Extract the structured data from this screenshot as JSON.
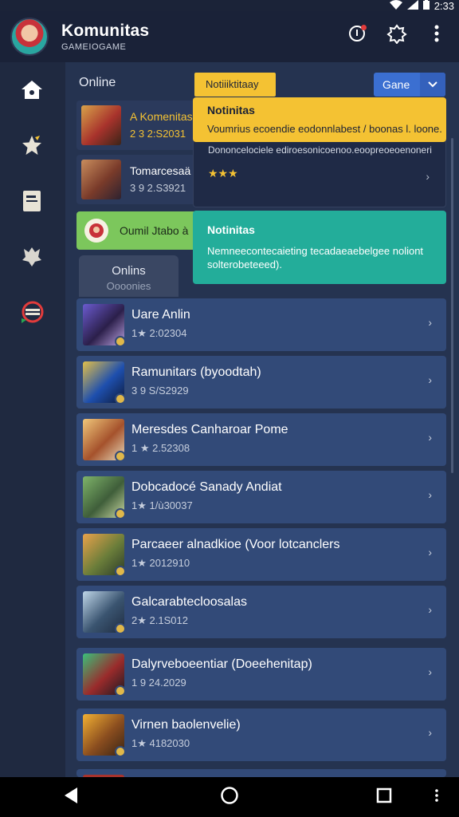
{
  "status_bar": {
    "time": "2:33"
  },
  "app": {
    "name": "Komunitas",
    "subtitle": "GAMEIOGAME"
  },
  "header": {
    "online_label": "Online",
    "tag_label": "Notiiiktitaay",
    "game_select_label": "Gane"
  },
  "mini_cards": [
    {
      "title": "A Komenitas",
      "meta": "2 3 2:S2031"
    },
    {
      "title": "Tomarcesaä",
      "meta": "3 9 2.S3921"
    }
  ],
  "green_banner": {
    "text": "Oumil Jtabo à"
  },
  "tab": {
    "label": "Onlins",
    "sublabel": "Oooonies"
  },
  "notifications": [
    {
      "title": "Notinitas",
      "text": "Voumrius ecoendie eodonnlabest / boonas l. loone."
    },
    {
      "text": "Dononcelociele ediroesonicoenoo.eoopreoeoenoneri",
      "stars": "★★★"
    },
    {
      "title": "Notinitas",
      "text": "Nemneecontecaieting tecadaeaebelgee noliont solterobeteeed)."
    }
  ],
  "list": [
    {
      "title": "Uare Anlin",
      "meta": "1★ 2:02304"
    },
    {
      "title": "Ramunitars (byoodtah)",
      "meta": "3 9 S/S2929"
    },
    {
      "title": "Meresdes Canharoar Pome",
      "meta": "1 ★ 2.52308"
    },
    {
      "title": "Dobcadocé Sanady Andiat",
      "meta": "1★ 1/ù30037"
    },
    {
      "title": "Parcaeer alnadkioe (Voor lotcanclers",
      "meta": "1★ 2012910"
    },
    {
      "title": "Galcarabtecloosalas",
      "meta": "2★ 2.1S012"
    },
    {
      "title": "Dalyrveboeentiar (Doeehenitap)",
      "meta": "1 9 24.2029"
    },
    {
      "title": "Virnen baolenvelie)",
      "meta": "1★ 4182030"
    }
  ],
  "icons": {
    "sidebar": [
      "home-icon",
      "star-icon",
      "document-icon",
      "badge-icon",
      "chat-icon"
    ],
    "appbar": [
      "notification-icon",
      "settings-icon",
      "more-icon"
    ],
    "navbar": [
      "back-icon",
      "home-circle-icon",
      "recents-icon",
      "menu-dots-icon"
    ]
  },
  "colors": {
    "accent_yellow": "#f4c233",
    "accent_teal": "#23ad9a",
    "accent_green": "#7cc75c",
    "select_blue": "#3b6fd1",
    "row_blue": "#324a78"
  }
}
